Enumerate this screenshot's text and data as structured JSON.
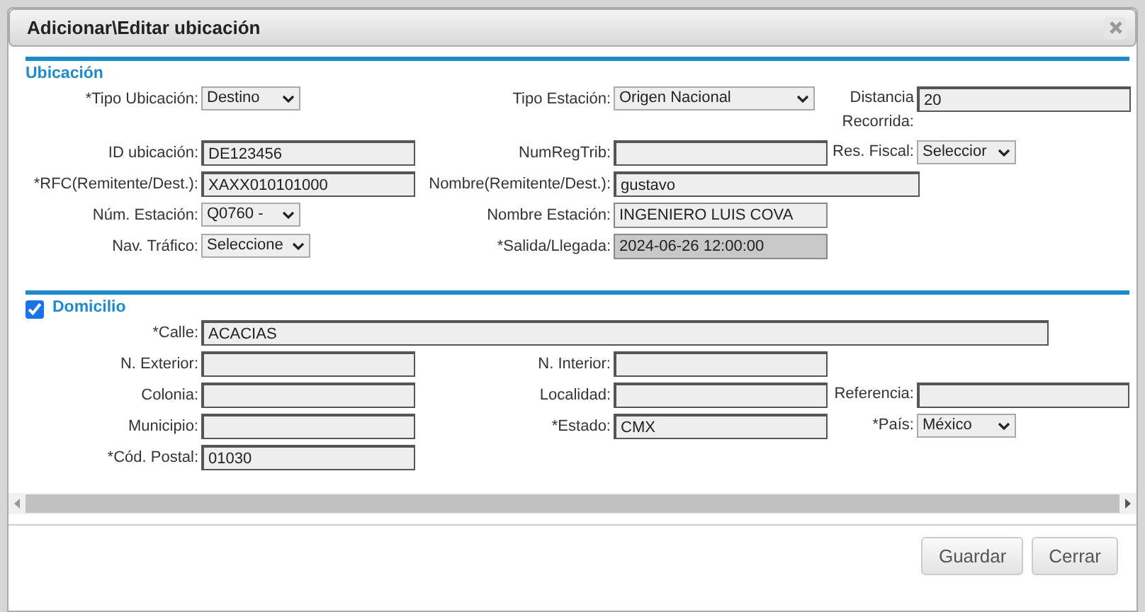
{
  "dialog": {
    "title": "Adicionar\\Editar ubicación"
  },
  "sections": [
    {
      "title": "Ubicación",
      "kind": "plain",
      "rows": [
        [
          {
            "label": "*Tipo Ubicación:",
            "kind": "select",
            "value": "Destino",
            "disabled": false
          },
          {
            "label": "Tipo Estación:",
            "kind": "select",
            "value": "Origen Nacional",
            "disabled": false
          },
          {
            "label": "Distancia Recorrida:",
            "kind": "input",
            "value": "20",
            "disabled": false
          }
        ],
        [
          {
            "label": "ID ubicación:",
            "kind": "input",
            "value": "DE123456",
            "disabled": false
          },
          {
            "label": "NumRegTrib:",
            "kind": "input",
            "disabled": false
          },
          {
            "label": "Res. Fiscal:",
            "kind": "select",
            "value": "Seleccior",
            "disabled": false
          }
        ],
        [
          {
            "label": "*RFC(Remitente/Dest.):",
            "kind": "input",
            "value": "XAXX010101000",
            "disabled": false
          },
          {
            "label": "Nombre(Remitente/Dest.):",
            "kind": "input",
            "value": "gustavo",
            "disabled": false
          }
        ],
        [
          {
            "label": "Núm. Estación:",
            "kind": "select",
            "value": "Q0760 -",
            "disabled": false
          },
          {
            "label": "Nombre Estación:",
            "kind": "readonly",
            "value": "INGENIERO LUIS COVA",
            "disabled": false
          }
        ],
        [
          {
            "label": "Nav. Tráfico:",
            "kind": "select",
            "value": "Seleccione",
            "disabled": false
          },
          {
            "label": "*Salida/Llegada:",
            "kind": "readonly",
            "value": "2024-06-26 12:00:00",
            "disabled": true
          }
        ]
      ]
    },
    {
      "title": "Domicilio",
      "kind": "checkbox",
      "checked": true,
      "rows": [
        [
          {
            "label": "*Calle:",
            "kind": "input",
            "value": "ACACIAS",
            "disabled": false
          }
        ],
        [
          {
            "label": "N. Exterior:",
            "kind": "input",
            "disabled": false
          },
          {
            "label": "N. Interior:",
            "kind": "input",
            "disabled": false
          }
        ],
        [
          {
            "label": "Colonia:",
            "kind": "input",
            "disabled": false
          },
          {
            "label": "Localidad:",
            "kind": "input",
            "disabled": false
          },
          {
            "label": "Referencia:",
            "kind": "input",
            "disabled": false
          }
        ],
        [
          {
            "label": "Municipio:",
            "kind": "input",
            "disabled": false
          },
          {
            "label": "*Estado:",
            "kind": "input",
            "value": "CMX",
            "disabled": false
          },
          {
            "label": "*País:",
            "kind": "select",
            "value": "México",
            "disabled": false
          }
        ],
        [
          {
            "label": "*Cód. Postal:",
            "kind": "input",
            "value": "01030",
            "disabled": false
          }
        ]
      ]
    }
  ],
  "buttons": [
    {
      "label": "Guardar"
    },
    {
      "label": "Cerrar"
    }
  ]
}
